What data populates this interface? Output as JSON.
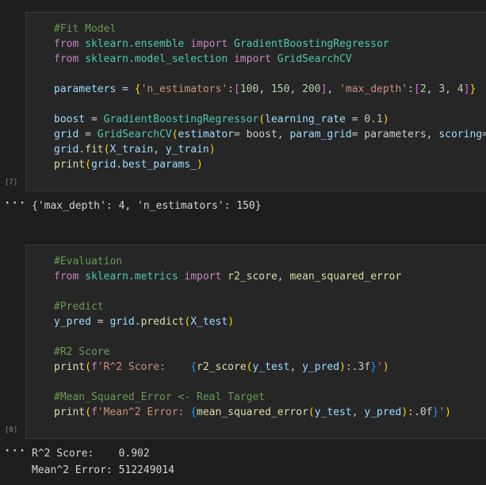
{
  "cells": [
    {
      "exec_label": "[7]",
      "code_lines": [
        [
          [
            "cm",
            "#Fit Model"
          ]
        ],
        [
          [
            "kw",
            "from "
          ],
          [
            "mod",
            "sklearn.ensemble"
          ],
          [
            "kw",
            " import "
          ],
          [
            "cls",
            "GradientBoostingRegressor"
          ]
        ],
        [
          [
            "kw",
            "from "
          ],
          [
            "mod",
            "sklearn.model_selection"
          ],
          [
            "kw",
            " import "
          ],
          [
            "cls",
            "GridSearchCV"
          ]
        ],
        [],
        [
          [
            "var",
            "parameters"
          ],
          [
            "tx",
            " = "
          ],
          [
            "brk",
            "{"
          ],
          [
            "str",
            "'n_estimators'"
          ],
          [
            "tx",
            ":"
          ],
          [
            "brk2",
            "["
          ],
          [
            "num",
            "100"
          ],
          [
            "tx",
            ", "
          ],
          [
            "num",
            "150"
          ],
          [
            "tx",
            ", "
          ],
          [
            "num",
            "200"
          ],
          [
            "brk2",
            "]"
          ],
          [
            "tx",
            ", "
          ],
          [
            "str",
            "'max_depth'"
          ],
          [
            "tx",
            ":"
          ],
          [
            "brk2",
            "["
          ],
          [
            "num",
            "2"
          ],
          [
            "tx",
            ", "
          ],
          [
            "num",
            "3"
          ],
          [
            "tx",
            ", "
          ],
          [
            "num",
            "4"
          ],
          [
            "brk2",
            "]"
          ],
          [
            "brk",
            "}"
          ]
        ],
        [],
        [
          [
            "var",
            "boost"
          ],
          [
            "tx",
            " = "
          ],
          [
            "cls",
            "GradientBoostingRegressor"
          ],
          [
            "brk",
            "("
          ],
          [
            "var",
            "learning_rate"
          ],
          [
            "tx",
            " = "
          ],
          [
            "num",
            "0.1"
          ],
          [
            "brk",
            ")"
          ]
        ],
        [
          [
            "var",
            "grid"
          ],
          [
            "tx",
            " = "
          ],
          [
            "cls",
            "GridSearchCV"
          ],
          [
            "brk",
            "("
          ],
          [
            "var",
            "estimator"
          ],
          [
            "tx",
            "= boost, "
          ],
          [
            "var",
            "param_grid"
          ],
          [
            "tx",
            "= parameters, "
          ],
          [
            "var",
            "scoring"
          ],
          [
            "tx",
            "="
          ]
        ],
        [
          [
            "var",
            "grid"
          ],
          [
            "tx",
            "."
          ],
          [
            "fn",
            "fit"
          ],
          [
            "brk",
            "("
          ],
          [
            "var",
            "X_train"
          ],
          [
            "tx",
            ", "
          ],
          [
            "var",
            "y_train"
          ],
          [
            "brk",
            ")"
          ]
        ],
        [
          [
            "fn",
            "print"
          ],
          [
            "brk",
            "("
          ],
          [
            "var",
            "grid"
          ],
          [
            "tx",
            "."
          ],
          [
            "var",
            "best_params_"
          ],
          [
            "brk",
            ")"
          ]
        ]
      ],
      "output_lines": [
        "{'max_depth': 4, 'n_estimators': 150}"
      ]
    },
    {
      "exec_label": "[8]",
      "code_lines": [
        [
          [
            "cm",
            "#Evaluation"
          ]
        ],
        [
          [
            "kw",
            "from "
          ],
          [
            "mod",
            "sklearn.metrics"
          ],
          [
            "kw",
            " import "
          ],
          [
            "fn",
            "r2_score"
          ],
          [
            "tx",
            ", "
          ],
          [
            "fn",
            "mean_squared_error"
          ]
        ],
        [],
        [
          [
            "cm",
            "#Predict"
          ]
        ],
        [
          [
            "var",
            "y_pred"
          ],
          [
            "tx",
            " = "
          ],
          [
            "var",
            "grid"
          ],
          [
            "tx",
            "."
          ],
          [
            "fn",
            "predict"
          ],
          [
            "brk",
            "("
          ],
          [
            "var",
            "X_test"
          ],
          [
            "brk",
            ")"
          ]
        ],
        [],
        [
          [
            "cm",
            "#R2 Score"
          ]
        ],
        [
          [
            "fn",
            "print"
          ],
          [
            "brk",
            "("
          ],
          [
            "kw",
            "f"
          ],
          [
            "str",
            "'R^2 Score:    "
          ],
          [
            "brk3",
            "{"
          ],
          [
            "fn",
            "r2_score"
          ],
          [
            "brk",
            "("
          ],
          [
            "var",
            "y_test"
          ],
          [
            "tx",
            ", "
          ],
          [
            "var",
            "y_pred"
          ],
          [
            "brk",
            ")"
          ],
          [
            "tx",
            ":.3f"
          ],
          [
            "brk3",
            "}"
          ],
          [
            "str",
            "'"
          ],
          [
            "brk",
            ")"
          ]
        ],
        [],
        [
          [
            "cm",
            "#Mean_Squared_Error <- Real Target"
          ]
        ],
        [
          [
            "fn",
            "print"
          ],
          [
            "brk",
            "("
          ],
          [
            "kw",
            "f"
          ],
          [
            "str",
            "'Mean^2 Error: "
          ],
          [
            "brk3",
            "{"
          ],
          [
            "fn",
            "mean_squared_error"
          ],
          [
            "brk",
            "("
          ],
          [
            "var",
            "y_test"
          ],
          [
            "tx",
            ", "
          ],
          [
            "var",
            "y_pred"
          ],
          [
            "brk",
            ")"
          ],
          [
            "tx",
            ":.0f"
          ],
          [
            "brk3",
            "}"
          ],
          [
            "str",
            "'"
          ],
          [
            "brk",
            ")"
          ]
        ]
      ],
      "output_lines": [
        "R^2 Score:    0.902",
        "Mean^2 Error: 512249014"
      ]
    }
  ],
  "output_indicator": "···"
}
